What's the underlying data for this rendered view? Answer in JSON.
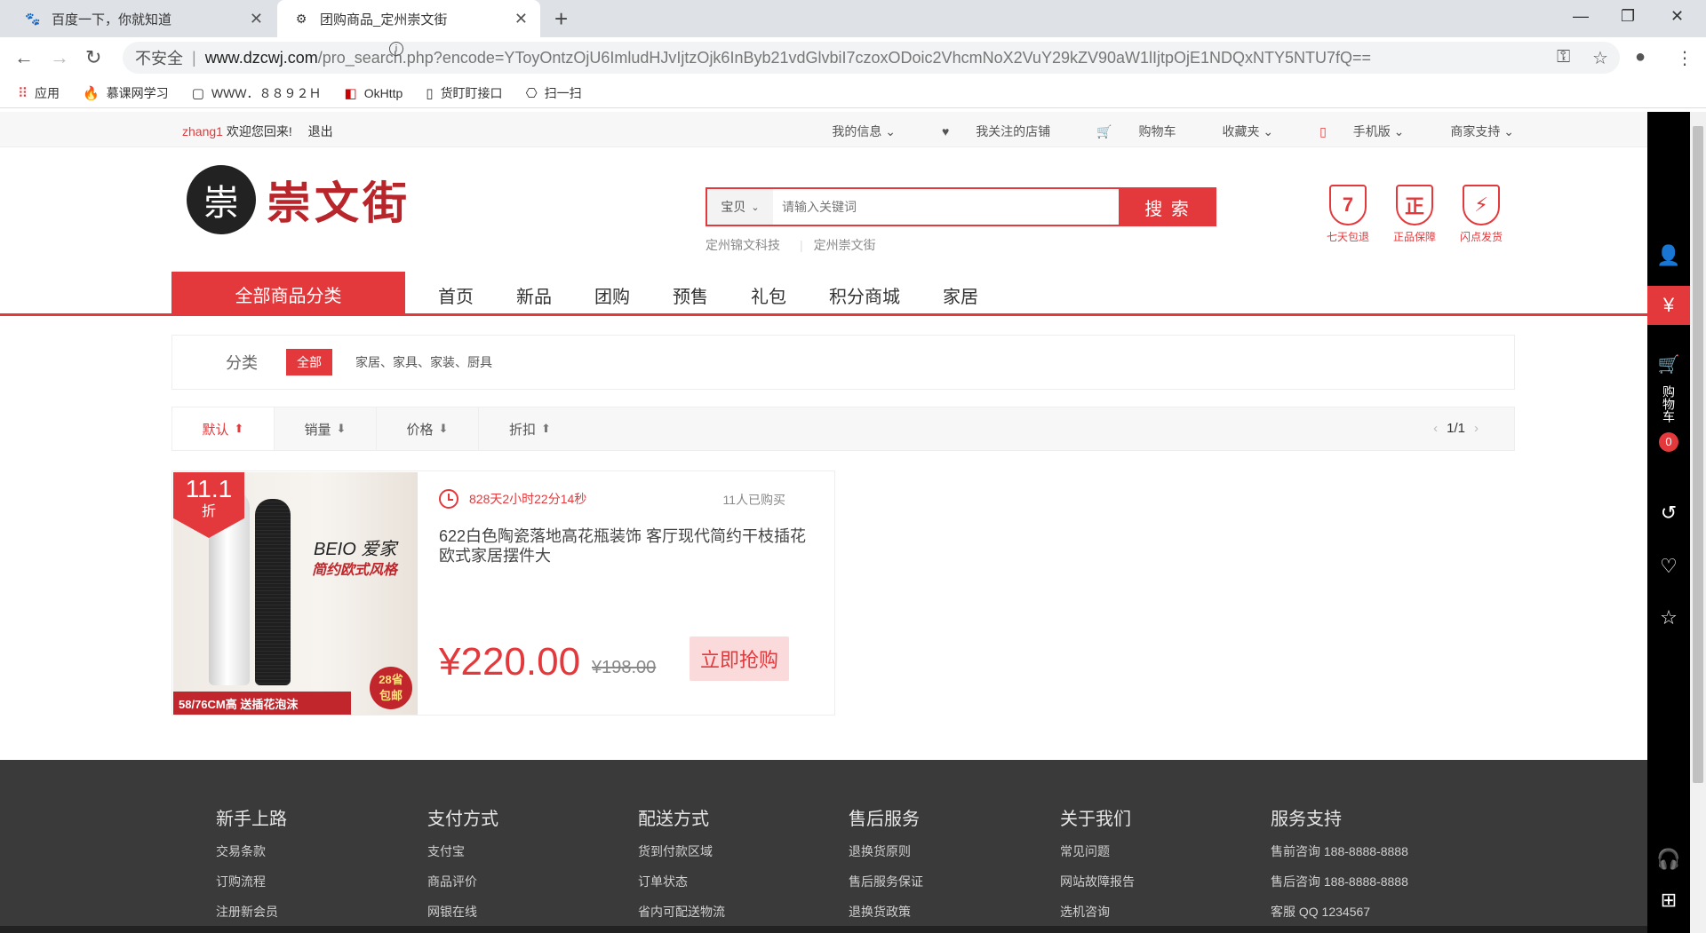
{
  "browser": {
    "tabs": [
      {
        "title": "百度一下，你就知道",
        "icon": "paw-icon"
      },
      {
        "title": "团购商品_定州崇文街",
        "icon": "site-icon"
      }
    ],
    "address": {
      "insecure_label": "不安全",
      "host": "www.dzcwj.com",
      "path": "/pro_search.php?encode=YToyOntzOjU6ImludHJvIjtzOjk6InByb21vdGlvbiI7czoxODoic2VhcmNoX2VuY29kZV90aW1lIjtpOjE1NDQxNTY5NTU7fQ=="
    },
    "bookmarks": [
      "应用",
      "慕课网学习",
      "WWW．８８９２Ｈ",
      "OkHttp",
      "货盯盯接口",
      "扫一扫"
    ]
  },
  "topbar": {
    "username": "zhang1",
    "welcome": "欢迎您回来!",
    "logout": "退出",
    "links": [
      "我的信息",
      "我关注的店铺",
      "购物车",
      "收藏夹",
      "手机版",
      "商家支持"
    ]
  },
  "logo": {
    "seal_char": "崇",
    "name": "崇文街"
  },
  "search": {
    "category": "宝贝",
    "placeholder": "请输入关键词",
    "button": "搜 索",
    "hotwords": [
      "定州锦文科技",
      "定州崇文街"
    ]
  },
  "guarantees": [
    {
      "symbol": "7",
      "label": "七天包退"
    },
    {
      "symbol": "正",
      "label": "正品保障"
    },
    {
      "symbol": "⚡",
      "label": "闪点发货"
    }
  ],
  "nav": {
    "all_categories": "全部商品分类",
    "links": [
      "首页",
      "新品",
      "团购",
      "预售",
      "礼包",
      "积分商城",
      "家居"
    ]
  },
  "filter": {
    "label": "分类",
    "selected": "全部",
    "categories": "家居、家具、家装、厨具"
  },
  "sort": {
    "options": [
      "默认",
      "销量",
      "价格",
      "折扣"
    ],
    "page": "1/1"
  },
  "product": {
    "discount_value": "11.1",
    "discount_unit": "折",
    "image_text1": "BEIO 爱家",
    "image_text2": "简约欧式风格",
    "image_badge": "28省\n包邮",
    "image_bar": "58/76CM高 送插花泡沫",
    "countdown": "828天2小时22分14秒",
    "sold": "11人已购买",
    "title": "622白色陶瓷落地高花瓶装饰 客厅现代简约干枝插花欧式家居摆件大",
    "price": "¥220.00",
    "old_price": "¥198.00",
    "buy_button": "立即抢购"
  },
  "footer": [
    {
      "heading": "新手上路",
      "items": [
        "交易条款",
        "订购流程",
        "注册新会员"
      ]
    },
    {
      "heading": "支付方式",
      "items": [
        "支付宝",
        "商品评价",
        "网银在线"
      ]
    },
    {
      "heading": "配送方式",
      "items": [
        "货到付款区域",
        "订单状态",
        "省内可配送物流"
      ]
    },
    {
      "heading": "售后服务",
      "items": [
        "退换货原则",
        "售后服务保证",
        "退换货政策"
      ]
    },
    {
      "heading": "关于我们",
      "items": [
        "常见问题",
        "网站故障报告",
        "选机咨询"
      ]
    },
    {
      "heading": "服务支持",
      "items": [
        "售前咨询 188-8888-8888",
        "售后咨询 188-8888-8888",
        "客服 QQ 1234567"
      ]
    }
  ],
  "sidebar": {
    "cart_label": "购物车",
    "cart_count": "0"
  },
  "colors": {
    "accent": "#e4393c",
    "footer_bg": "#3a3a3a"
  }
}
